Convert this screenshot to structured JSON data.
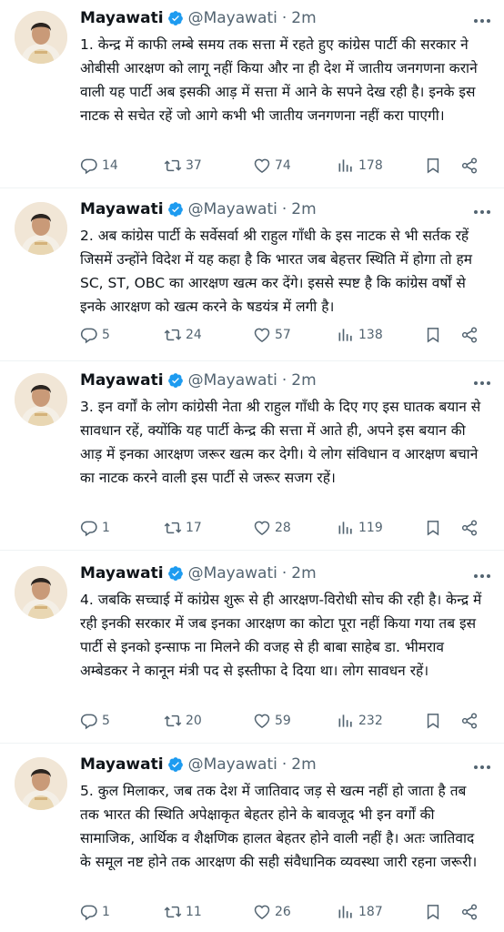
{
  "tweets": [
    {
      "author": "Mayawati",
      "handle": "@Mayawati",
      "separator": "·",
      "time": "2m",
      "text": "1. केन्द्र में काफी लम्बे समय तक सत्ता में रहते हुए कांग्रेस पार्टी की सरकार ने ओबीसी आरक्षण को लागू नहीं किया और ना ही देश में जातीय जनगणना कराने वाली यह पार्टी अब इसकी आड़ में सत्ता में आने के सपने देख रही है। इनके इस नाटक से सचेत रहें जो आगे कभी भी जातीय जनगणना नहीं करा पाएगी।",
      "replies": "14",
      "retweets": "37",
      "likes": "74",
      "views": "178"
    },
    {
      "author": "Mayawati",
      "handle": "@Mayawati",
      "separator": "·",
      "time": "2m",
      "text": "2. अब कांग्रेस पार्टी के सर्वेसर्वा श्री राहुल गाँधी के इस नाटक से भी सर्तक रहें जिसमें उन्होंने विदेश में यह कहा है कि भारत जब बेहत्तर स्थिति में होगा तो हम SC, ST, OBC का आरक्षण खत्म कर देंगे। इससे स्पष्ट है कि कांग्रेस वर्षों से इनके आरक्षण को खत्म करने के षडयंत्र में लगी है।",
      "replies": "5",
      "retweets": "24",
      "likes": "57",
      "views": "138"
    },
    {
      "author": "Mayawati",
      "handle": "@Mayawati",
      "separator": "·",
      "time": "2m",
      "text": "3. इन वर्गों के लोग कांग्रेसी नेता श्री राहुल गाँधी के दिए गए इस घातक बयान से सावधान रहें, क्योंकि यह पार्टी केन्द्र की सत्ता में आते ही, अपने इस बयान की आड़ में इनका आरक्षण जरूर खत्म कर देगी। ये लोग संविधान व आरक्षण बचाने का नाटक करने वाली इस पार्टी से जरूर सजग रहें।",
      "replies": "1",
      "retweets": "17",
      "likes": "28",
      "views": "119"
    },
    {
      "author": "Mayawati",
      "handle": "@Mayawati",
      "separator": "·",
      "time": "2m",
      "text": "4. जबकि सच्चाई में कांग्रेस शुरू से ही आरक्षण-विरोधी सोच की रही है। केन्द्र में रही इनकी सरकार में जब इनका आरक्षण का कोटा पूरा नहीं किया गया तब इस पार्टी से इनको इन्साफ ना मिलने की वजह से ही बाबा साहेब डा. भीमराव अम्बेडकर ने कानून मंत्री पद से इस्तीफा दे दिया था। लोग सावधन रहें।",
      "replies": "5",
      "retweets": "20",
      "likes": "59",
      "views": "232"
    },
    {
      "author": "Mayawati",
      "handle": "@Mayawati",
      "separator": "·",
      "time": "2m",
      "text": "5. कुल मिलाकर, जब तक देश में जातिवाद जड़ से खत्म नहीं हो जाता है तब तक भारत की स्थिति अपेक्षाकृत बेहतर होने के बावजूद भी इन वर्गों की सामाजिक, आर्थिक व शैक्षणिक हालत बेहतर होने वाली नहीं है। अतः जातिवाद के समूल नष्ट होने तक आरक्षण की सही संवैधानिक व्यवस्था जारी रहना जरूरी।",
      "replies": "1",
      "retweets": "11",
      "likes": "26",
      "views": "187"
    }
  ],
  "icons": {
    "verified": "verified-badge-icon",
    "reply": "reply-icon",
    "retweet": "retweet-icon",
    "like": "heart-icon",
    "views": "views-icon",
    "bookmark": "bookmark-icon",
    "share": "share-icon",
    "more": "more-icon"
  },
  "colors": {
    "verified_blue": "#1d9bf0",
    "secondary_text": "#536471",
    "divider": "#eff3f4"
  }
}
